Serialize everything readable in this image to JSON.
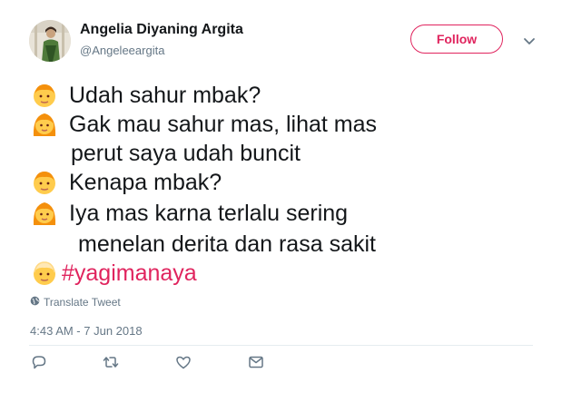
{
  "author": {
    "name": "Angelia Diyaning Argita",
    "handle": "@Angeleeargita"
  },
  "follow_label": "Follow",
  "tweet": {
    "lines": [
      {
        "emoji": "boy-emoji",
        "text": "Udah sahur mbak?"
      },
      {
        "emoji": "woman-emoji",
        "text": "Gak mau sahur mas, lihat mas",
        "continuation": "perut saya udah buncit"
      },
      {
        "emoji": "boy-emoji",
        "text": "Kenapa mbak?"
      },
      {
        "emoji": "woman-emoji",
        "text": "Iya mas karna terlalu sering",
        "continuation": "menelan derita dan rasa sakit"
      },
      {
        "emoji": "blond-emoji",
        "hashtag": "#yagimanaya"
      }
    ]
  },
  "translate_label": "Translate Tweet",
  "timestamp": "4:43 AM - 7 Jun 2018",
  "icons": {
    "reply": "reply-icon",
    "retweet": "retweet-icon",
    "like": "like-icon",
    "dm": "message-icon",
    "more": "chevron-down-icon",
    "globe": "globe-icon"
  },
  "colors": {
    "accent": "#e0245e",
    "muted": "#657786",
    "text": "#14171a"
  }
}
